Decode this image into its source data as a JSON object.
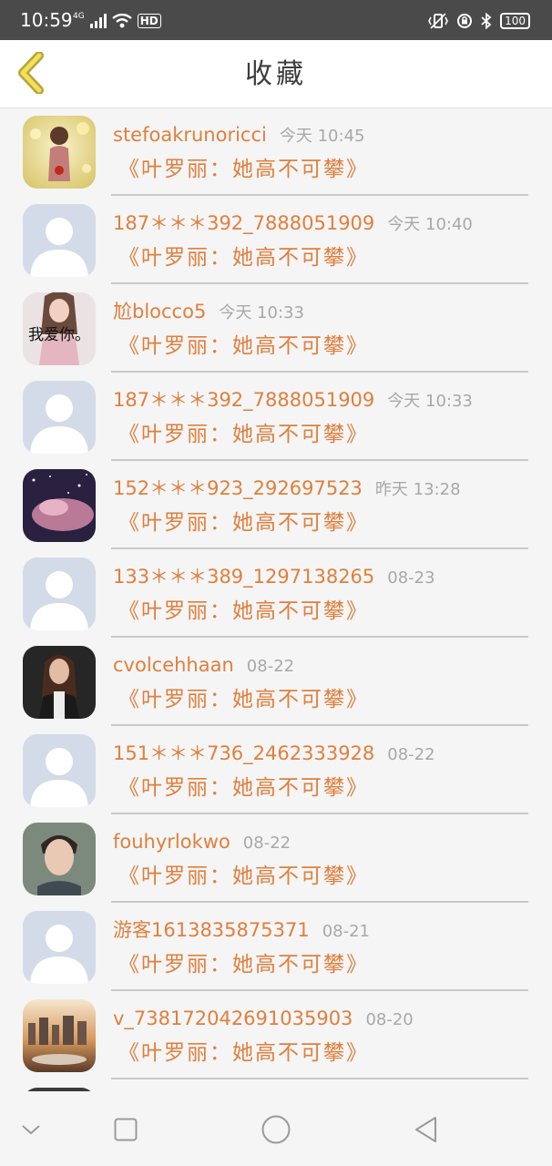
{
  "status": {
    "time": "10:59",
    "network": "4G",
    "hd": "HD",
    "battery": "100"
  },
  "header": {
    "title": "收藏",
    "back_icon": "chevron-left-icon"
  },
  "accent_color": "#e07f3d",
  "items": [
    {
      "name": "stefoakrunoricci",
      "time": "今天 10:45",
      "book": "《叶罗丽：她高不可攀》",
      "avatar": "girl-photo"
    },
    {
      "name": "187＊＊＊392_7888051909",
      "time": "今天 10:40",
      "book": "《叶罗丽：她高不可攀》",
      "avatar": "default"
    },
    {
      "name": "尬blocco5",
      "time": "今天 10:33",
      "book": "《叶罗丽：她高不可攀》",
      "avatar": "girl-text",
      "avatar_text": "我爱你。"
    },
    {
      "name": "187＊＊＊392_7888051909",
      "time": "今天 10:33",
      "book": "《叶罗丽：她高不可攀》",
      "avatar": "default"
    },
    {
      "name": "152＊＊＊923_292697523",
      "time": "昨天 13:28",
      "book": "《叶罗丽：她高不可攀》",
      "avatar": "night-photo"
    },
    {
      "name": "133＊＊＊389_1297138265",
      "time": "08-23",
      "book": "《叶罗丽：她高不可攀》",
      "avatar": "default"
    },
    {
      "name": "cvolcehhaan",
      "time": "08-22",
      "book": "《叶罗丽：她高不可攀》",
      "avatar": "woman-photo"
    },
    {
      "name": "151＊＊＊736_2462333928",
      "time": "08-22",
      "book": "《叶罗丽：她高不可攀》",
      "avatar": "default"
    },
    {
      "name": "fouhyrlokwo",
      "time": "08-22",
      "book": "《叶罗丽：她高不可攀》",
      "avatar": "man-photo"
    },
    {
      "name": "游客1613835875371",
      "time": "08-21",
      "book": "《叶罗丽：她高不可攀》",
      "avatar": "default"
    },
    {
      "name": "v_738172042691035903",
      "time": "08-20",
      "book": "《叶罗丽：她高不可攀》",
      "avatar": "city-photo"
    },
    {
      "name": "",
      "time": "",
      "book": "",
      "avatar": "dark-photo"
    }
  ],
  "nav": {
    "down_icon": "chevron-down-icon",
    "recents_icon": "square-icon",
    "home_icon": "circle-icon",
    "back_icon": "triangle-back-icon"
  }
}
